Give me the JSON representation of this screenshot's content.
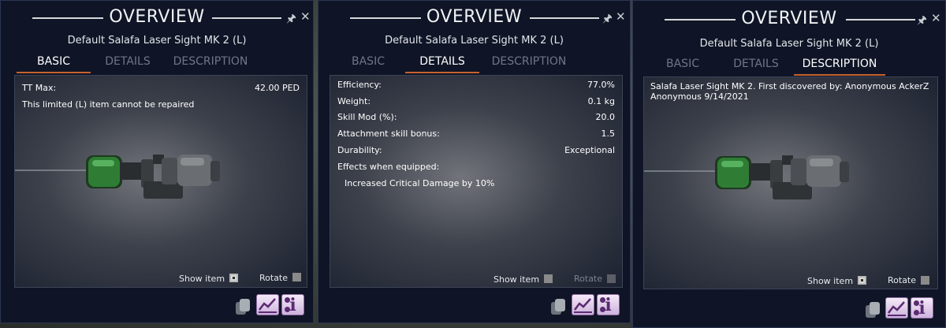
{
  "window_title": "OVERVIEW",
  "item_name": "Default Salafa Laser Sight MK 2 (L)",
  "tabs": [
    "BASIC",
    "DETAILS",
    "DESCRIPTION"
  ],
  "icons": {
    "pin": "pin-icon",
    "close": "close-icon",
    "copy": "copy-icon",
    "chart": "chart-icon",
    "info": "info-icon"
  },
  "basic": {
    "tt_max_label": "TT Max:",
    "tt_max_value": "42.00 PED",
    "repair_note": "This limited (L) item cannot be repaired"
  },
  "details": {
    "rows": [
      {
        "label": "Efficiency:",
        "value": "77.0%"
      },
      {
        "label": "Weight:",
        "value": "0.1 kg"
      },
      {
        "label": "Skill Mod (%):",
        "value": "20.0"
      },
      {
        "label": "Attachment skill bonus:",
        "value": "1.5"
      },
      {
        "label": "Durability:",
        "value": "Exceptional"
      },
      {
        "label": "Effects when equipped:",
        "value": ""
      }
    ],
    "effect": "Increased Critical Damage by 10%"
  },
  "description": {
    "text": "Salafa Laser Sight MK 2.  First discovered by: Anonymous AckerZ Anonymous 9/14/2021"
  },
  "controls": {
    "show_item": "Show item",
    "rotate": "Rotate"
  },
  "colors": {
    "accent": "#c8612e",
    "panel": "#0f1526",
    "info_button": "#cdb2dc"
  }
}
